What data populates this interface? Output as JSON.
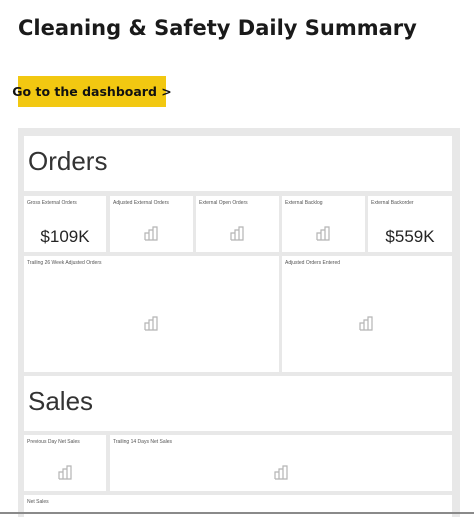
{
  "page": {
    "title": "Cleaning & Safety Daily Summary",
    "dashboard_button_label": "Go to the dashboard >",
    "accent_color": "#f2c811"
  },
  "sections": {
    "orders": {
      "title": "Orders",
      "tiles": {
        "gross_external_orders": {
          "label": "Gross External Orders",
          "value": "$109K"
        },
        "adjusted_external_orders": {
          "label": "Adjusted External Orders",
          "icon": "chart-placeholder-icon"
        },
        "external_open_orders": {
          "label": "External Open Orders",
          "icon": "chart-placeholder-icon"
        },
        "external_backlog": {
          "label": "External Backlog",
          "icon": "chart-placeholder-icon"
        },
        "external_backorder": {
          "label": "External Backorder",
          "value": "$559K"
        },
        "trailing_26_week": {
          "label": "Trailing 26 Week Adjusted Orders",
          "icon": "chart-placeholder-icon"
        },
        "adjusted_orders_entered": {
          "label": "Adjusted Orders Entered",
          "icon": "chart-placeholder-icon"
        }
      }
    },
    "sales": {
      "title": "Sales",
      "tiles": {
        "previous_day_net_sales": {
          "label": "Previous Day Net Sales",
          "icon": "chart-placeholder-icon"
        },
        "trailing_14_days_net_sales": {
          "label": "Trailing 14 Days Net Sales",
          "icon": "chart-placeholder-icon"
        },
        "net_sales": {
          "label": "Net Sales"
        }
      }
    }
  }
}
